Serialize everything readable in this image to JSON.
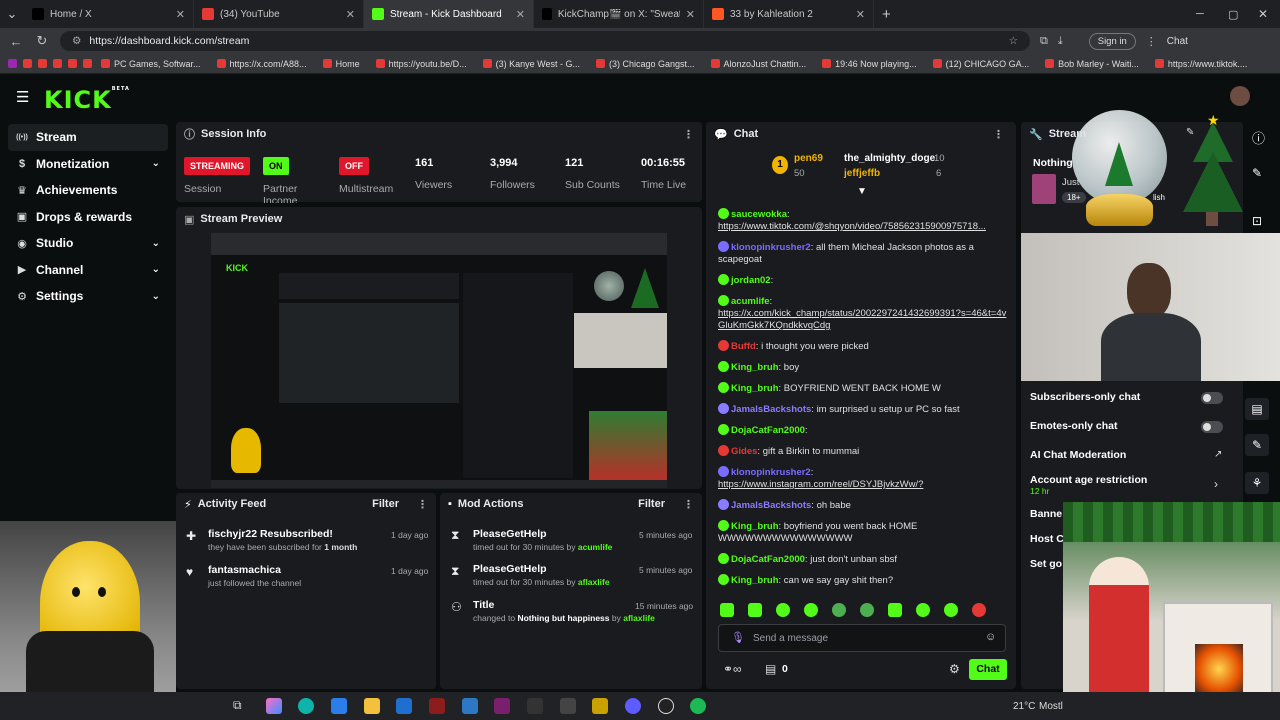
{
  "browser": {
    "tabs": [
      {
        "title": "Home / X",
        "color": "#000000",
        "icon": "x-logo-icon"
      },
      {
        "title": "(34) YouTube",
        "color": "#e53935",
        "icon": "youtube-icon"
      },
      {
        "title": "Stream - Kick Dashboard",
        "color": "#53fc18",
        "icon": "kick-icon"
      },
      {
        "title": "KickChamp🎬 on X: \"Sweatergxd",
        "color": "#000000",
        "icon": "x-logo-icon"
      },
      {
        "title": "33 by Kahleation 2",
        "color": "#ff5722",
        "icon": "music-icon"
      }
    ],
    "new_tab": "+",
    "url": "https://dashboard.kick.com/stream",
    "sign_in": "Sign in",
    "chat_btn": "Chat",
    "bookmarks": [
      "PC Games, Softwar...",
      "https://x.com/A88...",
      "Home",
      "https://youtu.be/D...",
      "(3) Kanye West - G...",
      "(3) Chicago Gangst...",
      "AlonzoJust Chattin...",
      "19:46 Now playing...",
      "(12) CHICAGO GA...",
      "Bob Marley - Waiti...",
      "https://www.tiktok...."
    ]
  },
  "sidebar": {
    "logo": "KICK",
    "beta": "BETA",
    "items": [
      {
        "label": "Stream",
        "icon": "stream-icon",
        "chevron": false
      },
      {
        "label": "Monetization",
        "icon": "money-icon",
        "chevron": true
      },
      {
        "label": "Achievements",
        "icon": "trophy-icon",
        "chevron": false
      },
      {
        "label": "Drops & rewards",
        "icon": "gift-icon",
        "chevron": false
      },
      {
        "label": "Studio",
        "icon": "studio-icon",
        "chevron": true
      },
      {
        "label": "Channel",
        "icon": "channel-icon",
        "chevron": true
      },
      {
        "label": "Settings",
        "icon": "gear-icon",
        "chevron": true
      }
    ]
  },
  "session": {
    "title": "Session Info",
    "streaming": "STREAMING",
    "session_label": "Session",
    "partner_badge": "ON",
    "partner_label": "Partner Income",
    "multistream_badge": "OFF",
    "multistream_label": "Multistream",
    "viewers": "161",
    "viewers_label": "Viewers",
    "followers": "3,994",
    "followers_label": "Followers",
    "subs": "121",
    "subs_label": "Sub Counts",
    "time": "00:16:55",
    "time_label": "Time Live"
  },
  "preview": {
    "title": "Stream Preview"
  },
  "activity": {
    "title": "Activity Feed",
    "filter": "Filter",
    "items": [
      {
        "title": "fischyjr22 Resubscribed!",
        "sub_a": "they have been subscribed for ",
        "sub_b": "1 month",
        "time": "1 day ago"
      },
      {
        "title": "fantasmachica",
        "sub_a": "just followed the channel",
        "sub_b": "",
        "time": "1 day ago"
      }
    ]
  },
  "mod": {
    "title": "Mod Actions",
    "filter": "Filter",
    "items": [
      {
        "title": "PleaseGetHelp",
        "sub": "timed out for 30 minutes by ",
        "by": "acumlife",
        "time": "5 minutes ago"
      },
      {
        "title": "PleaseGetHelp",
        "sub": "timed out for 30 minutes by ",
        "by": "aflaxlife",
        "time": "5 minutes ago"
      },
      {
        "title": "Title",
        "sub": "changed to ",
        "bold": "Nothing but happiness",
        "sub2": " by ",
        "by": "aflaxlife",
        "time": "15 minutes ago"
      }
    ]
  },
  "chat": {
    "title": "Chat",
    "leaders": [
      {
        "name": "pen69",
        "count": "50"
      },
      {
        "name": "the_almighty_doge",
        "count": "10"
      },
      {
        "name": "jeffjeffb",
        "count": "6"
      }
    ],
    "messages": [
      {
        "user": "saucewokka",
        "color": "#53fc18",
        "text": "",
        "link": "https://www.tiktok.com/@shqyon/video/758562315900975718..."
      },
      {
        "user": "klonopinkrusher2",
        "color": "#7b6cff",
        "text": "all them Micheal Jackson photos as a scapegoat",
        "link": ""
      },
      {
        "user": "jordan02",
        "color": "#53fc18",
        "text": "",
        "link": ""
      },
      {
        "user": "acumlife",
        "color": "#53fc18",
        "text": "",
        "link": "https://x.com/kick_champ/status/2002297241432699391?s=46&t=4vGluKmGkk7KQndkkvqCdg"
      },
      {
        "user": "Buffd",
        "color": "#e53935",
        "text": "i thought you were picked",
        "link": ""
      },
      {
        "user": "King_bruh",
        "color": "#53fc18",
        "text": "boy",
        "link": ""
      },
      {
        "user": "King_bruh",
        "color": "#53fc18",
        "text": "BOYFRIEND WENT BACK HOME W",
        "link": ""
      },
      {
        "user": "JamalsBackshots",
        "color": "#8a7cff",
        "text": "im surprised u setup ur PC so fast",
        "link": ""
      },
      {
        "user": "DojaCatFan2000",
        "color": "#53fc18",
        "text": "",
        "link": ""
      },
      {
        "user": "Gides",
        "color": "#e53935",
        "text": "gift a Birkin to mummai",
        "link": ""
      },
      {
        "user": "klonopinkrusher2",
        "color": "#7b6cff",
        "text": "",
        "link": "https://www.instagram.com/reel/DSYJBjvkzWw/?"
      },
      {
        "user": "JamalsBackshots",
        "color": "#8a7cff",
        "text": "oh babe",
        "link": ""
      },
      {
        "user": "King_bruh",
        "color": "#53fc18",
        "text": "boyfriend you went back HOME WWWWWWWWWWWWWWW",
        "link": ""
      },
      {
        "user": "DojaCatFan2000",
        "color": "#53fc18",
        "text": "just don't unban sbsf",
        "link": ""
      },
      {
        "user": "King_bruh",
        "color": "#53fc18",
        "text": "can we say gay shit then?",
        "link": ""
      }
    ],
    "placeholder": "Send a message",
    "points": "0",
    "send": "Chat"
  },
  "streampanel": {
    "title": "Stream",
    "stream_title": "Nothing",
    "sub": "Just",
    "rating": "18+",
    "lang": "lish"
  },
  "settings": {
    "subs_only": "Subscribers-only chat",
    "emotes_only": "Emotes-only chat",
    "ai_mod": "AI Chat Moderation",
    "age": "Account age restriction",
    "age_val": "12 hr",
    "banned": "Banne",
    "host": "Host Cl",
    "goal": "Set go"
  },
  "taskbar": {
    "temp": "21°C",
    "weather": "Mostl"
  }
}
